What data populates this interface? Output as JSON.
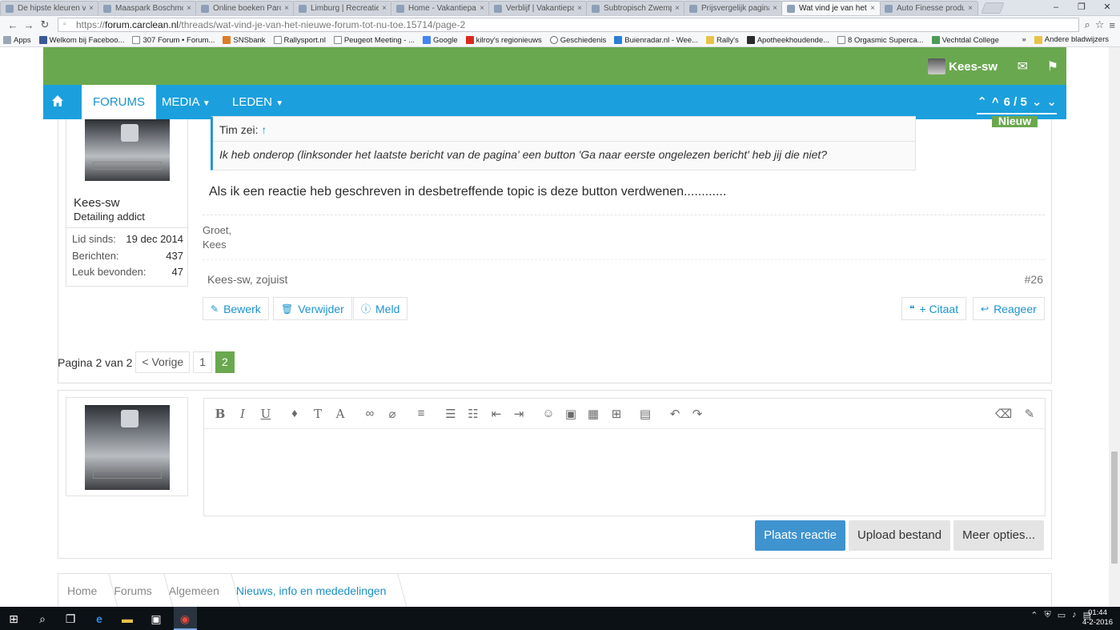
{
  "browser": {
    "tabs": [
      {
        "label": "De hipste kleuren van"
      },
      {
        "label": "Maaspark Boschmole"
      },
      {
        "label": "Online boeken Parc c"
      },
      {
        "label": "Limburg | RecreatieP"
      },
      {
        "label": "Home - Vakantiepark"
      },
      {
        "label": "Verblijf | Vakantiepar"
      },
      {
        "label": "Subtropisch Zwempa"
      },
      {
        "label": "Prijsvergelijk pagina"
      },
      {
        "label": "Wat vind je van het n"
      },
      {
        "label": "Auto Finesse producte"
      }
    ],
    "active_tab_index": 8,
    "url_scheme": "https://",
    "url_host": "forum.carclean.nl",
    "url_path": "/threads/wat-vind-je-van-het-nieuwe-forum-tot-nu-toe.15714/page-2",
    "bookmarks": [
      "Apps",
      "Welkom bij Faceboo...",
      "307 Forum • Forum...",
      "SNSbank",
      "Rallysport.nl",
      "Peugeot Meeting - ...",
      "Google",
      "kilroy's regionieuws",
      "Geschiedenis",
      "Buienradar.nl - Wee...",
      "Rally's",
      "Apotheekhoudende...",
      "8 Orgasmic Superca...",
      "Vechtdal College"
    ],
    "bookmarks_other": "Andere bladwijzers"
  },
  "site": {
    "username_top": "Kees-sw",
    "nav": {
      "forums": "FORUMS",
      "media": "MEDIA",
      "members": "LEDEN"
    },
    "page_indicator": "6 / 5"
  },
  "post": {
    "badge": "Nieuw",
    "quote_author": "Tim zei:",
    "quote_arrow": "↑",
    "quote_text": "Ik heb onderop (linksonder het laatste bericht van de pagina' een button 'Ga naar eerste ongelezen bericht' heb jij die niet?",
    "message": "Als ik een reactie heb geschreven in desbetreffende topic is deze button verdwenen............",
    "signature_line1": "Groet,",
    "signature_line2": "Kees",
    "meta": "Kees-sw, zojuist",
    "number": "#26",
    "buttons": {
      "edit": "Bewerk",
      "delete": "Verwijder",
      "report": "Meld",
      "quote": "+ Citaat",
      "reply": "Reageer"
    }
  },
  "author": {
    "name": "Kees-sw",
    "title": "Detailing addict",
    "stats": [
      {
        "label": "Lid sinds:",
        "value": "19 dec 2014"
      },
      {
        "label": "Berichten:",
        "value": "437"
      },
      {
        "label": "Leuk bevonden:",
        "value": "47"
      }
    ]
  },
  "pagination": {
    "label": "Pagina 2 van 2",
    "prev": "< Vorige",
    "pages": [
      "1",
      "2"
    ],
    "current": "2"
  },
  "editor": {
    "actions": {
      "post": "Plaats reactie",
      "upload": "Upload bestand",
      "more": "Meer opties..."
    }
  },
  "breadcrumb": [
    "Home",
    "Forums",
    "Algemeen",
    "Nieuws, info en mededelingen"
  ],
  "taskbar": {
    "time": "01:44",
    "date": "4-2-2016"
  },
  "colors": {
    "green": "#6aa84f",
    "blue": "#1ba0dd",
    "link": "#1b93cf",
    "primary_button": "#3f93cf"
  }
}
